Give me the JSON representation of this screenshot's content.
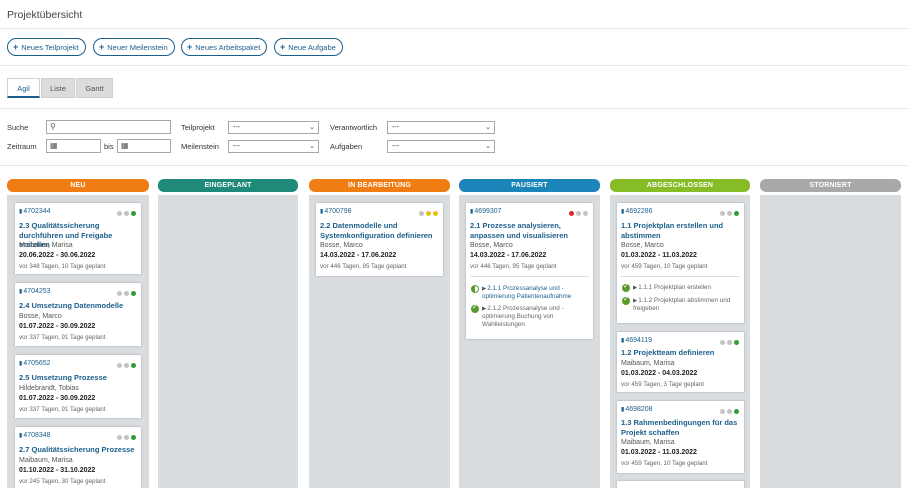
{
  "page": {
    "title": "Projektübersicht"
  },
  "actions": [
    {
      "label": "Neues Teilprojekt"
    },
    {
      "label": "Neuer Meilenstein"
    },
    {
      "label": "Neues Arbeitspaket"
    },
    {
      "label": "Neue Aufgabe"
    }
  ],
  "tabs": [
    {
      "label": "Agil",
      "active": true
    },
    {
      "label": "Liste",
      "active": false
    },
    {
      "label": "Gantt",
      "active": false
    }
  ],
  "filters": {
    "search_label": "Suche",
    "search_value": "",
    "period_label": "Zeitraum",
    "period_to": "bis",
    "subproject_label": "Teilprojekt",
    "subproject_value": "---",
    "milestone_label": "Meilenstein",
    "milestone_value": "---",
    "responsible_label": "Verantwortlich",
    "responsible_value": "---",
    "tasks_label": "Aufgaben",
    "tasks_value": "---"
  },
  "columns": [
    {
      "label": "NEU",
      "color": "#f07d13"
    },
    {
      "label": "EINGEPLANT",
      "color": "#1f8a7a"
    },
    {
      "label": "IN BEARBEITUNG",
      "color": "#f07d13"
    },
    {
      "label": "PAUSIERT",
      "color": "#1b84b8"
    },
    {
      "label": "ABGESCHLOSSEN",
      "color": "#86bc25"
    },
    {
      "label": "STORNIERT",
      "color": "#a9a9a9"
    }
  ],
  "cards": {
    "neu": [
      {
        "number": "4702344",
        "title": "2.3 Qualitätssicherung durchführen und Freigabe erstellen",
        "person": "Maibaum, Marisa",
        "dates": "20.06.2022 - 30.06.2022",
        "meta": "vor 348 Tagen, 10 Tage geplant",
        "status": [
          "grey",
          "grey",
          "green"
        ]
      },
      {
        "number": "4704253",
        "title": "2.4 Umsetzung Datenmodelle",
        "person": "Bosse, Marco",
        "dates": "01.07.2022 - 30.09.2022",
        "meta": "vor 337 Tagen, 91 Tage geplant",
        "status": [
          "grey",
          "grey",
          "green"
        ]
      },
      {
        "number": "4705652",
        "title": "2.5 Umsetzung Prozesse",
        "person": "Hildebrandt, Tobias",
        "dates": "01.07.2022 - 30.09.2022",
        "meta": "vor 337 Tagen, 91 Tage geplant",
        "status": [
          "grey",
          "grey",
          "green"
        ]
      },
      {
        "number": "4708348",
        "title": "2.7 Qualitätssicherung Prozesse",
        "person": "Maibaum, Marisa",
        "dates": "01.10.2022 - 31.10.2022",
        "meta": "vor 245 Tagen, 30 Tage geplant",
        "status": [
          "grey",
          "grey",
          "green"
        ]
      }
    ],
    "bearbeitung": [
      {
        "number": "4700798",
        "title": "2.2 Datenmodelle und Systemkonfiguration definieren",
        "person": "Bosse, Marco",
        "dates": "14.03.2022 - 17.06.2022",
        "meta": "vor 446 Tagen, 95 Tage geplant",
        "status": [
          "grey",
          "yellow",
          "yellow"
        ]
      }
    ],
    "pausiert": [
      {
        "number": "4699307",
        "title": "2.1 Prozesse analysieren, anpassen und visualisieren",
        "person": "Bosse, Marco",
        "dates": "14.03.2022 - 17.06.2022",
        "meta": "vor 446 Tagen, 95 Tage geplant",
        "status": [
          "red",
          "grey",
          "grey"
        ],
        "subs": [
          {
            "text": "2.1.1 Prozessanalyse und -optimierung Patientenaufnahme"
          },
          {
            "text": "2.1.2 Prozessanalyse und -optimierung Buchung von Wahlleistungen"
          }
        ]
      }
    ],
    "abgeschlossen": [
      {
        "number": "4692286",
        "title": "1.1 Projektplan erstellen und abstimmen",
        "person": "Bosse, Marco",
        "dates": "01.03.2022 - 11.03.2022",
        "meta": "vor 459 Tagen, 10 Tage geplant",
        "status": [
          "grey",
          "grey",
          "green"
        ],
        "subs": [
          {
            "text": "1.1.1 Projektplan erstellen"
          },
          {
            "text": "1.1.2 Projektplan abstimmen und freigeben"
          }
        ]
      },
      {
        "number": "4694119",
        "title": "1.2 Projektteam definieren",
        "person": "Maibaum, Marisa",
        "dates": "01.03.2022 - 04.03.2022",
        "meta": "vor 459 Tagen, 3 Tage geplant",
        "status": [
          "grey",
          "grey",
          "green"
        ]
      },
      {
        "number": "4698208",
        "title": "1.3 Rahmenbedingungen für das Projekt schaffen",
        "person": "Maibaum, Marisa",
        "dates": "01.03.2022 - 11.03.2022",
        "meta": "vor 459 Tagen, 10 Tage geplant",
        "status": [
          "grey",
          "grey",
          "green"
        ]
      }
    ]
  },
  "colors": {
    "accent": "#1b5f8c",
    "dot_grey": "#c4c4c4",
    "dot_green": "#2e9e3a",
    "dot_yellow": "#e8c21a",
    "dot_red": "#d8262b"
  }
}
